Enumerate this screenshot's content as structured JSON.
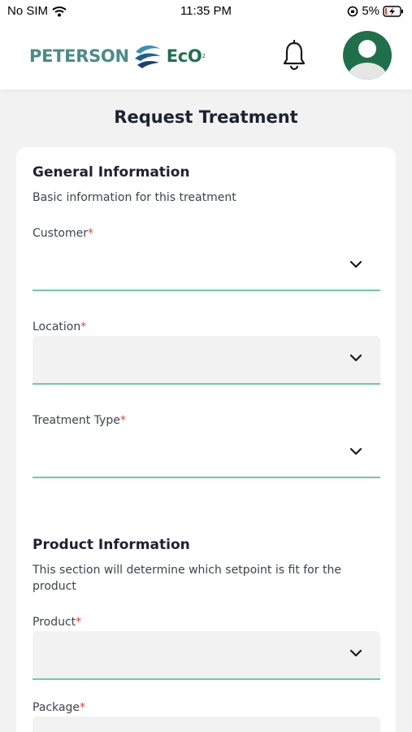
{
  "status_bar": {
    "carrier": "No SIM",
    "time": "11:35 PM",
    "battery": "5%"
  },
  "header": {
    "logo_left": "PETERSON",
    "logo_right": "EcO",
    "logo_sub": "2"
  },
  "page": {
    "title": "Request Treatment"
  },
  "general": {
    "title": "General Information",
    "description": "Basic information for this treatment",
    "fields": [
      {
        "label": "Customer",
        "required": "*"
      },
      {
        "label": "Location",
        "required": "*"
      },
      {
        "label": "Treatment Type",
        "required": "*"
      }
    ]
  },
  "product": {
    "title": "Product Information",
    "description": "This section will determine which setpoint is fit for the product",
    "fields": [
      {
        "label": "Product",
        "required": "*"
      },
      {
        "label": "Package",
        "required": "*"
      }
    ]
  },
  "colors": {
    "brand_green": "#1f6f4b",
    "brand_teal": "#4b8c89",
    "underline": "#6dcaa8",
    "required": "#e0443a"
  }
}
